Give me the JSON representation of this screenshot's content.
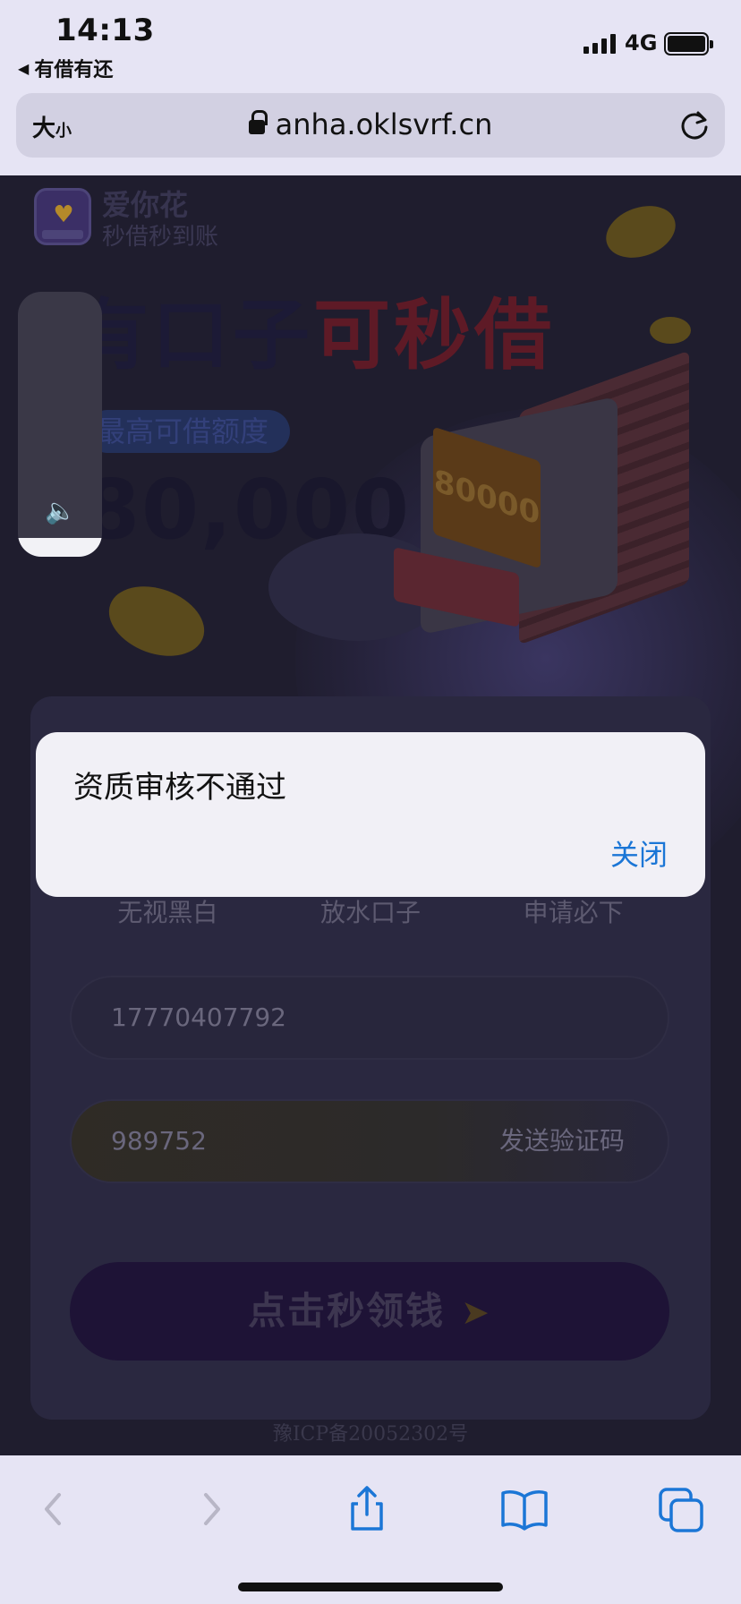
{
  "status_bar": {
    "time": "14:13",
    "back_app": "有借有还",
    "network": "4G"
  },
  "address_bar": {
    "text_size_big": "大",
    "text_size_small": "小",
    "url": "anha.oklsvrf.cn"
  },
  "page": {
    "brand_name": "爱你花",
    "brand_slogan": "秒借秒到账",
    "headline_part1": "有口子",
    "headline_part2": "可秒借",
    "quota_label": "最高可借额度",
    "quota_amount": "80,000",
    "machine_display": "80000",
    "tags": [
      "无视黑白",
      "放水口子",
      "申请必下"
    ],
    "phone_value": "17770407792",
    "code_value": "989752",
    "send_code_label": "发送验证码",
    "claim_label": "点击秒领钱",
    "icp": "豫ICP备20052302号"
  },
  "volume_hud": {
    "level": 0.07
  },
  "alert": {
    "message": "资质审核不通过",
    "close_label": "关闭"
  },
  "colors": {
    "accent": "#1b76d6",
    "chrome_bg": "#e6e4f4"
  }
}
